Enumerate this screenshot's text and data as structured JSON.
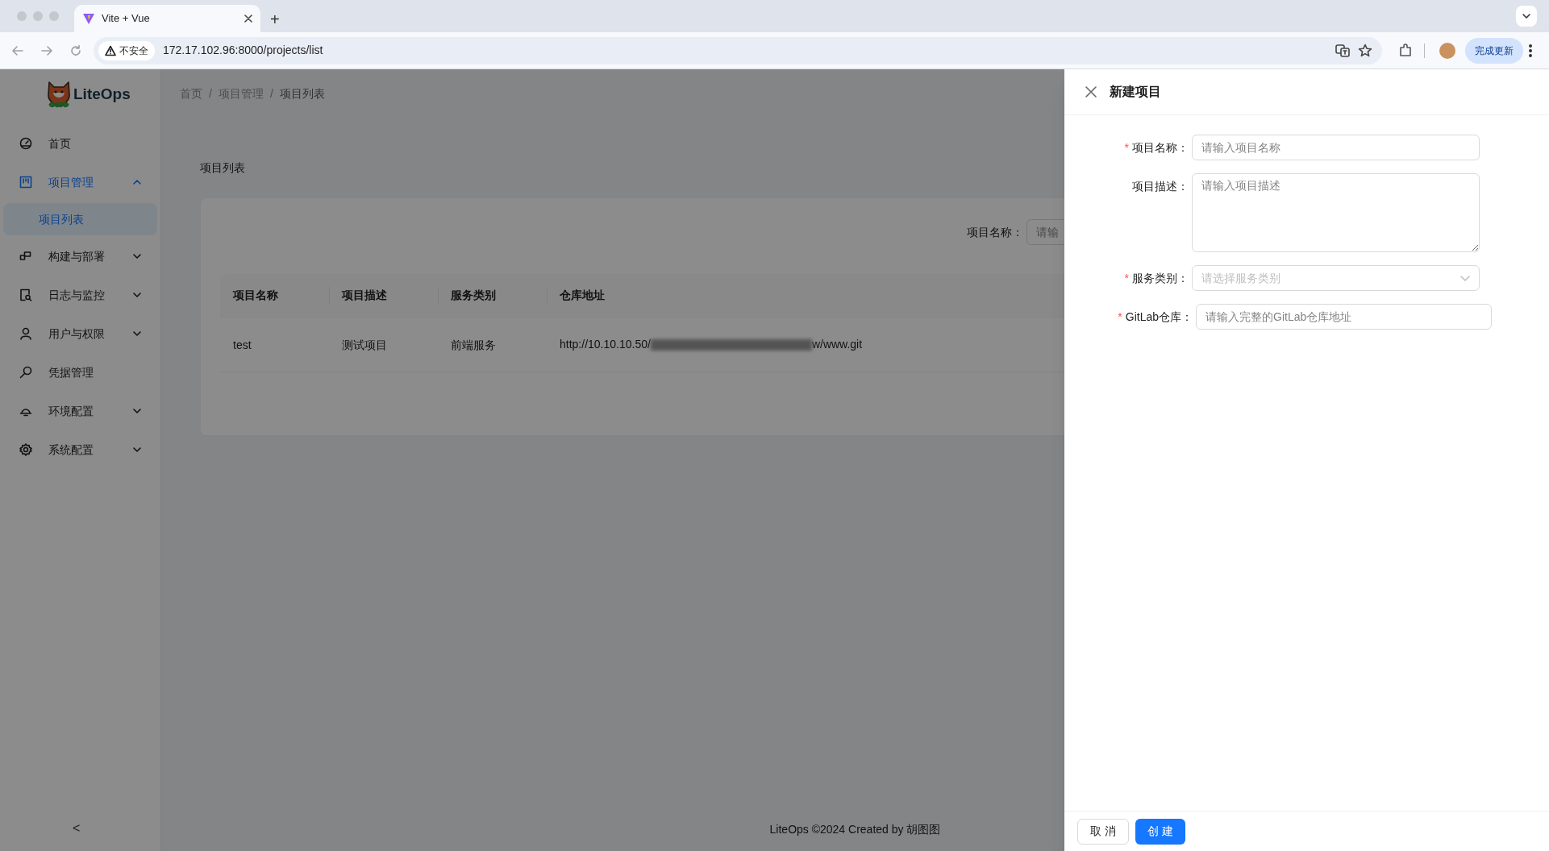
{
  "browser": {
    "tab_title": "Vite + Vue",
    "new_tab": "+",
    "security_label": "不安全",
    "url": "172.17.102.96:8000/projects/list",
    "update_button": "完成更新"
  },
  "sidebar": {
    "logo_text": "LiteOps",
    "items": [
      {
        "label": "首页",
        "selected": false
      },
      {
        "label": "项目管理",
        "selected": true,
        "expanded": true,
        "children": [
          {
            "label": "项目列表",
            "selected": true
          }
        ]
      },
      {
        "label": "构建与部署",
        "selected": false,
        "expanded": false
      },
      {
        "label": "日志与监控",
        "selected": false,
        "expanded": false
      },
      {
        "label": "用户与权限",
        "selected": false,
        "expanded": false
      },
      {
        "label": "凭据管理",
        "selected": false
      },
      {
        "label": "环境配置",
        "selected": false,
        "expanded": false
      },
      {
        "label": "系统配置",
        "selected": false,
        "expanded": false
      }
    ],
    "collapse": "<"
  },
  "breadcrumb": [
    "首页",
    "/",
    "项目管理",
    "/",
    "项目列表"
  ],
  "page_title": "项目列表",
  "search": {
    "label": "项目名称：",
    "placeholder": "请输"
  },
  "table": {
    "columns": [
      "项目名称",
      "项目描述",
      "服务类别",
      "仓库地址"
    ],
    "rows": [
      {
        "cells": [
          "test",
          "测试项目",
          "前端服务"
        ],
        "repo_start": "http://10.10.10.50/",
        "repo_end": "w/www.git"
      }
    ]
  },
  "footer": "LiteOps ©2024 Created by 胡图图",
  "drawer": {
    "title": "新建项目",
    "fields": [
      {
        "kind": "input",
        "required_mark": "*",
        "label": "项目名称：",
        "placeholder": "请输入项目名称"
      },
      {
        "kind": "textarea",
        "label": "项目描述：",
        "placeholder": "请输入项目描述"
      },
      {
        "kind": "select",
        "required_mark": "*",
        "label": "服务类别：",
        "placeholder": "请选择服务类别"
      },
      {
        "kind": "input",
        "required_mark": "*",
        "label": "GitLab仓库：",
        "placeholder": "请输入完整的GitLab仓库地址"
      }
    ],
    "buttons": [
      {
        "label": "取 消",
        "primary": false
      },
      {
        "label": "创 建",
        "primary": true
      }
    ]
  }
}
